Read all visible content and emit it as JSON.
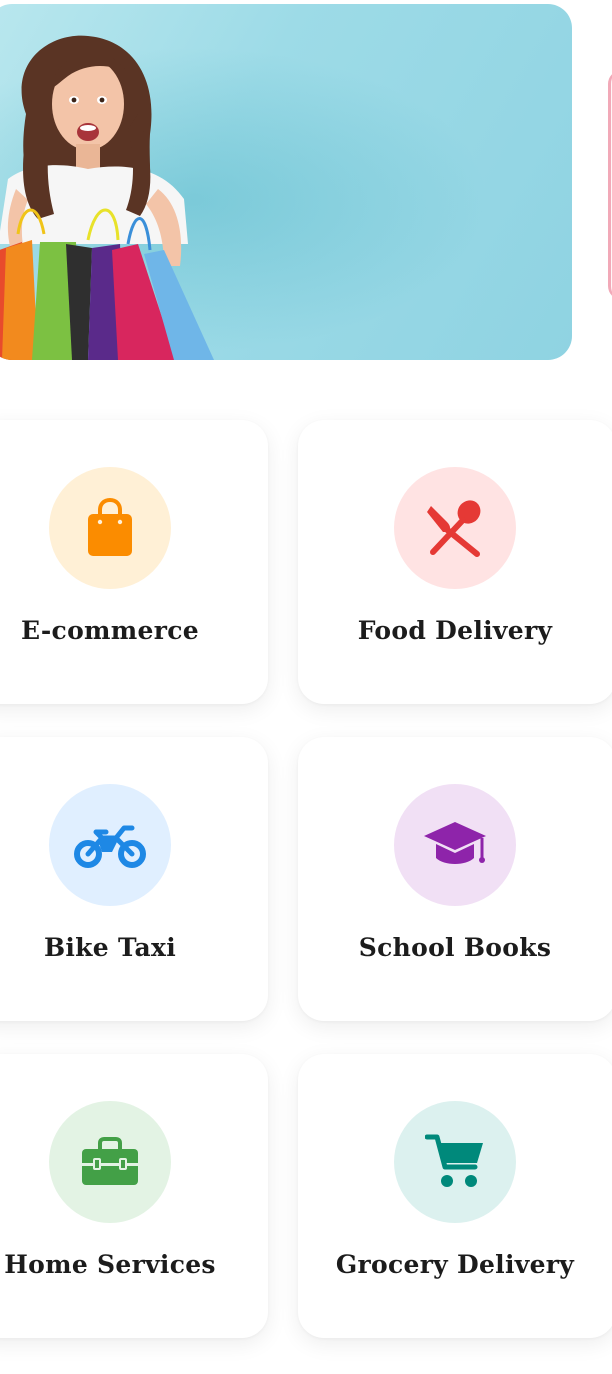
{
  "banner": {
    "background_color": "#9ddbe7",
    "peek_accent_color": "#f2a9b8"
  },
  "categories": [
    {
      "label": "E-commerce",
      "icon": "shopping-bag-icon",
      "icon_color": "#fb8c00",
      "circle_color": "#fff0d6"
    },
    {
      "label": "Food Delivery",
      "icon": "fork-spoon-icon",
      "icon_color": "#e53935",
      "circle_color": "#ffe3e3"
    },
    {
      "label": "Bike Taxi",
      "icon": "motorcycle-icon",
      "icon_color": "#1e88e5",
      "circle_color": "#e0efff"
    },
    {
      "label": "School Books",
      "icon": "graduation-cap-icon",
      "icon_color": "#8e24aa",
      "circle_color": "#f1e0f5"
    },
    {
      "label": "Home Services",
      "icon": "toolbox-icon",
      "icon_color": "#43a047",
      "circle_color": "#e3f3e4"
    },
    {
      "label": "Grocery Delivery",
      "icon": "shopping-cart-icon",
      "icon_color": "#00897b",
      "circle_color": "#dcf1ef"
    }
  ]
}
